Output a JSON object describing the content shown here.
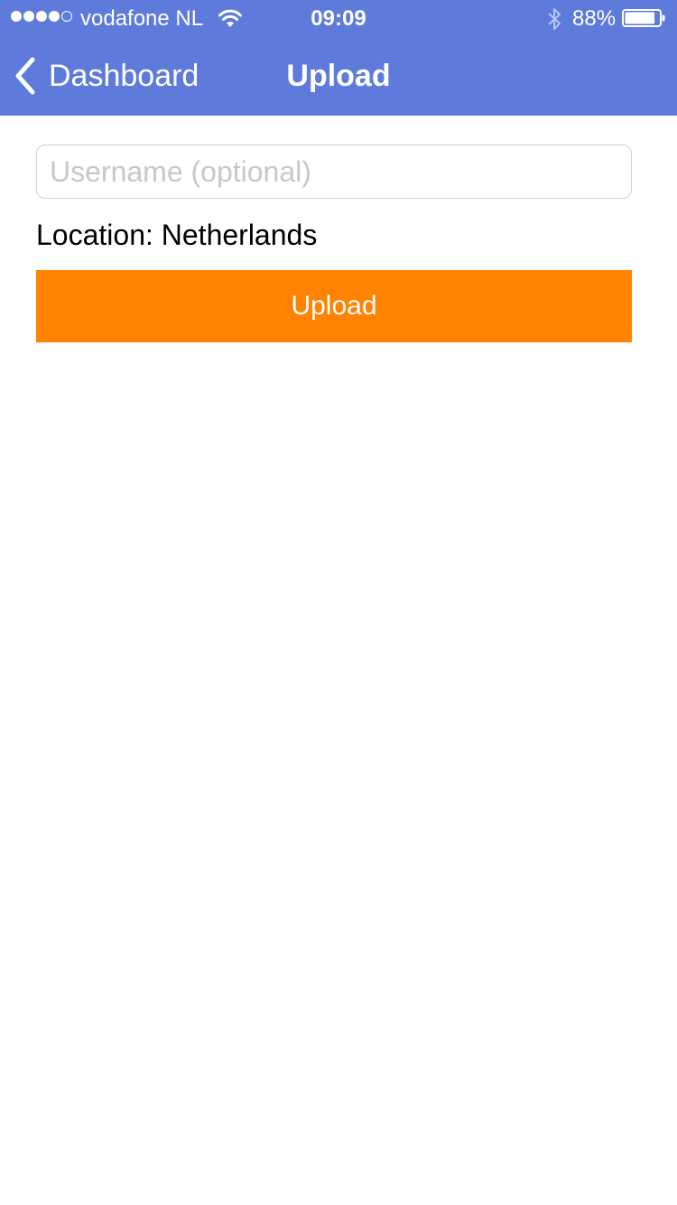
{
  "status_bar": {
    "carrier": "vodafone NL",
    "signal_bars_filled": 4,
    "signal_bars_total": 5,
    "time": "09:09",
    "battery_percent": "88%",
    "battery_level": 0.88
  },
  "nav": {
    "back_label": "Dashboard",
    "title": "Upload"
  },
  "form": {
    "username_placeholder": "Username (optional)",
    "username_value": "",
    "location_text": "Location: Netherlands",
    "upload_button_label": "Upload"
  },
  "colors": {
    "nav_background": "#5e7bdb",
    "upload_button": "#ff8200",
    "text_on_accent": "#ffffff"
  },
  "icons": {
    "signal": "signal-dots-icon",
    "wifi": "wifi-icon",
    "bluetooth": "bluetooth-icon",
    "battery": "battery-icon",
    "back": "chevron-left-icon"
  }
}
